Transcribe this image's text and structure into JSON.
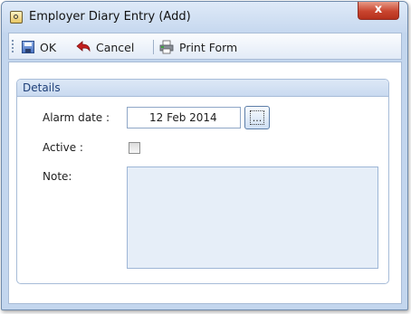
{
  "window": {
    "title": "Employer Diary Entry (Add)",
    "close_label": "x"
  },
  "toolbar": {
    "ok_label": "OK",
    "cancel_label": "Cancel",
    "print_label": "Print Form"
  },
  "details": {
    "header": "Details",
    "alarm_date_label": "Alarm date :",
    "alarm_date_value": "12 Feb 2014",
    "date_button_label": "...",
    "active_label": "Active :",
    "active_checked": false,
    "note_label": "Note:",
    "note_value": ""
  },
  "colors": {
    "accent": "#c3d6ee",
    "close": "#c9452f"
  }
}
